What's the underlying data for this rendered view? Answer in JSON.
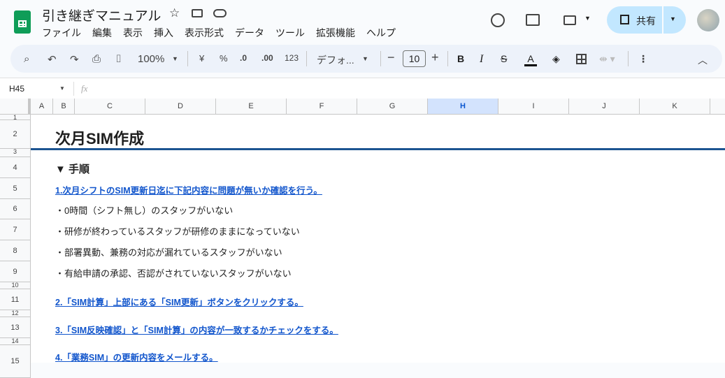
{
  "doc": {
    "title": "引き継ぎマニュアル"
  },
  "menu": [
    "ファイル",
    "編集",
    "表示",
    "挿入",
    "表示形式",
    "データ",
    "ツール",
    "拡張機能",
    "ヘルプ"
  ],
  "toolbar": {
    "zoom": "100%",
    "currency": "¥",
    "percent": "%",
    "dec_decrease": ".0",
    "dec_increase": ".00",
    "number_format": "123",
    "font": "デフォ...",
    "font_size": "10"
  },
  "share": {
    "label": "共有"
  },
  "formula_bar": {
    "name_box": "H45",
    "fx": "fx",
    "value": ""
  },
  "columns": [
    "A",
    "B",
    "C",
    "D",
    "E",
    "F",
    "G",
    "H",
    "I",
    "J",
    "K"
  ],
  "selected_column": "H",
  "rows": [
    "1",
    "2",
    "3",
    "4",
    "5",
    "6",
    "7",
    "8",
    "9",
    "10",
    "11",
    "12",
    "13",
    "14",
    "15"
  ],
  "content": {
    "heading": "次月SIM作成",
    "section": "▼ 手順",
    "step1": "1.次月シフトのSIM更新日迄に下記内容に問題が無いか確認を行う。",
    "check1": "・0時間（シフト無し）のスタッフがいない",
    "check2": "・研修が終わっているスタッフが研修のままになっていない",
    "check3": "・部署異動、兼務の対応が漏れているスタッフがいない",
    "check4": "・有給申請の承認、否認がされていないスタッフがいない",
    "step2": "2.「SIM計算」上部にある「SIM更新」ボタンをクリックする。",
    "step3": "3.「SIM反映確認」と「SIM計算」の内容が一致するかチェックをする。",
    "step4": "4.「業務SIM」の更新内容をメールする。"
  },
  "colors": {
    "accent": "#1155cc",
    "header_rule": "#1c5491",
    "logo": "#0f9d58"
  }
}
